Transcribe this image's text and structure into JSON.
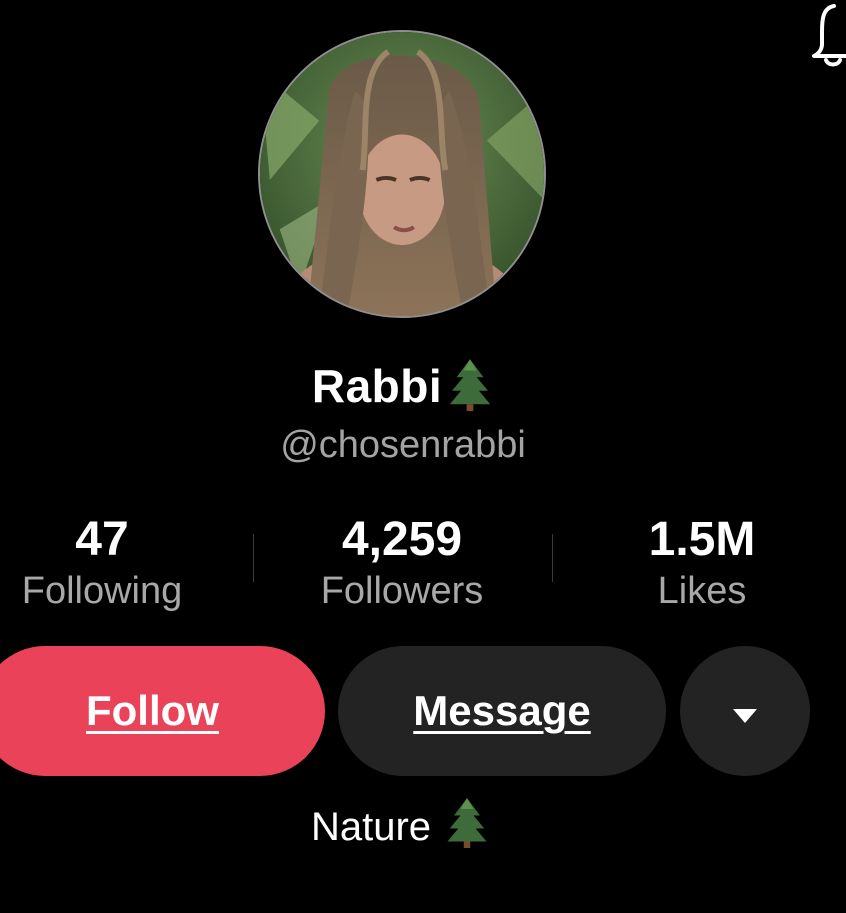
{
  "header": {
    "notification_icon": "bell-icon"
  },
  "profile": {
    "avatar_icon": "profile-photo",
    "display_name": "Rabbi",
    "name_emoji": "evergreen-tree-icon",
    "handle": "@chosenrabbi"
  },
  "stats": {
    "following": {
      "value": "47",
      "label": "Following"
    },
    "followers": {
      "value": "4,259",
      "label": "Followers"
    },
    "likes": {
      "value": "1.5M",
      "label": "Likes"
    }
  },
  "actions": {
    "follow_label": "Follow",
    "message_label": "Message",
    "more_icon": "caret-down-icon",
    "follow_color": "#ea4359",
    "secondary_color": "#232323"
  },
  "bio": {
    "text": "Nature",
    "emoji": "evergreen-tree-icon"
  }
}
